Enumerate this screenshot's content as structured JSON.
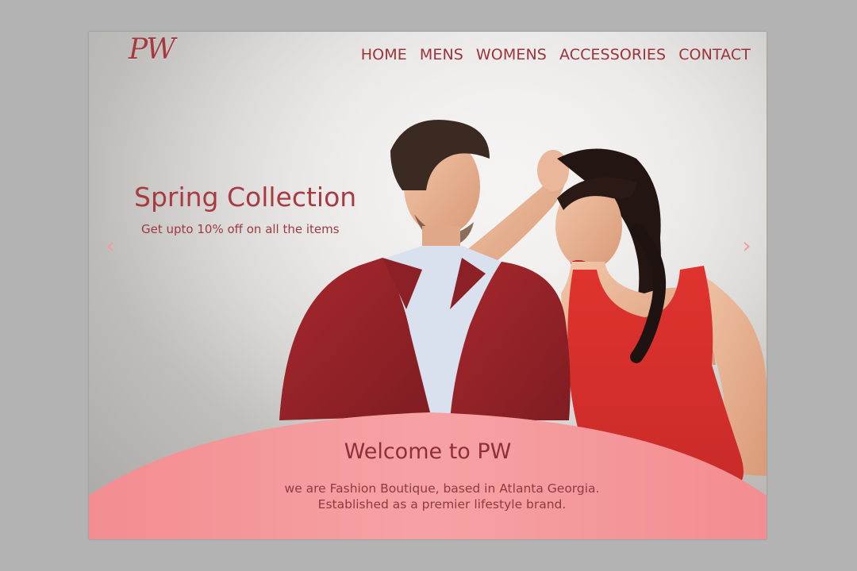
{
  "logo": {
    "text": "PW"
  },
  "nav": {
    "items": [
      {
        "label": "HOME"
      },
      {
        "label": "MENS"
      },
      {
        "label": "WOMENS"
      },
      {
        "label": "ACCESSORIES"
      },
      {
        "label": "CONTACT"
      }
    ]
  },
  "hero": {
    "title": "Spring Collection",
    "subtitle": "Get upto 10% off on all the items",
    "prev_icon": "chevron-left-icon",
    "next_icon": "chevron-right-icon",
    "prev_glyph": "‹",
    "next_glyph": "›"
  },
  "welcome": {
    "title": "Welcome to PW",
    "line1": "we are Fashion Boutique, based in Atlanta Georgia.",
    "line2": "Established as a premier lifestyle brand."
  },
  "colors": {
    "accent": "#a63a40",
    "welcome_bg": "#f4979a",
    "arrow": "#f29ca0",
    "page_bg": "#b3b3b3"
  }
}
